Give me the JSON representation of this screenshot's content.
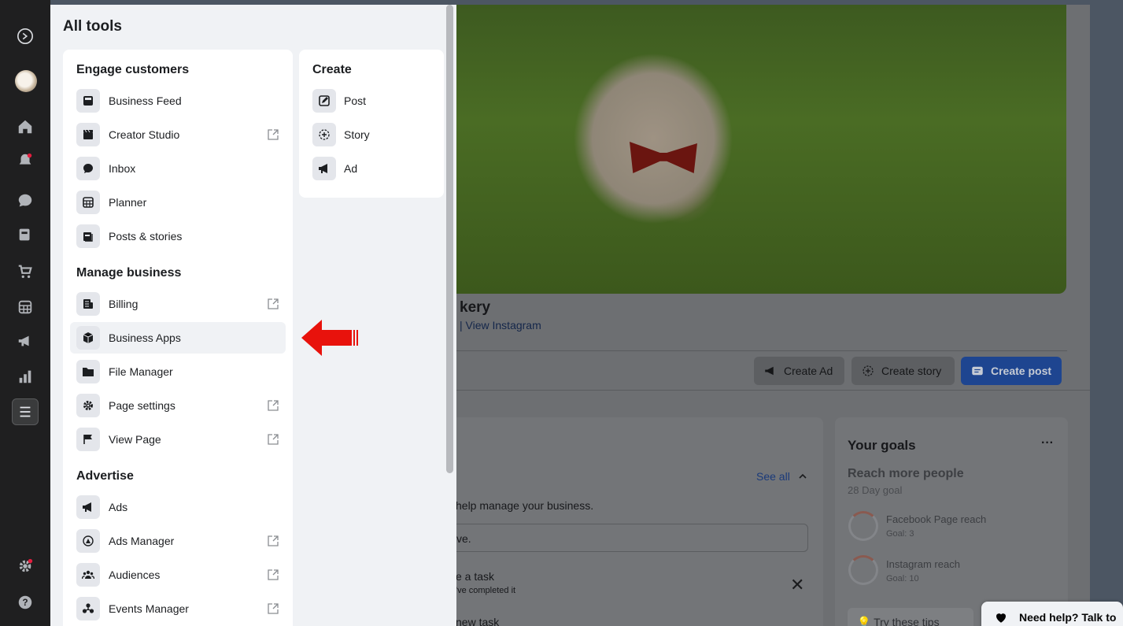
{
  "tools_panel": {
    "title": "All tools",
    "sections": {
      "engage": "Engage customers",
      "manage": "Manage business",
      "advertise": "Advertise",
      "create": "Create"
    },
    "engage_items": [
      {
        "label": "Business Feed",
        "icon": "business-feed-icon",
        "external": false
      },
      {
        "label": "Creator Studio",
        "icon": "creator-studio-icon",
        "external": true
      },
      {
        "label": "Inbox",
        "icon": "inbox-icon",
        "external": false
      },
      {
        "label": "Planner",
        "icon": "planner-icon",
        "external": false
      },
      {
        "label": "Posts & stories",
        "icon": "posts-stories-icon",
        "external": false
      }
    ],
    "manage_items": [
      {
        "label": "Billing",
        "icon": "billing-icon",
        "external": true
      },
      {
        "label": "Business Apps",
        "icon": "business-apps-icon",
        "external": false,
        "highlighted": true
      },
      {
        "label": "File Manager",
        "icon": "folder-icon",
        "external": false
      },
      {
        "label": "Page settings",
        "icon": "gear-icon",
        "external": true
      },
      {
        "label": "View Page",
        "icon": "flag-icon",
        "external": true
      }
    ],
    "advertise_items": [
      {
        "label": "Ads",
        "icon": "megaphone-icon",
        "external": false
      },
      {
        "label": "Ads Manager",
        "icon": "ads-manager-icon",
        "external": true
      },
      {
        "label": "Audiences",
        "icon": "audiences-icon",
        "external": true
      },
      {
        "label": "Events Manager",
        "icon": "events-manager-icon",
        "external": true
      }
    ],
    "create_items": [
      {
        "label": "Post",
        "icon": "compose-icon"
      },
      {
        "label": "Story",
        "icon": "story-add-icon"
      },
      {
        "label": "Ad",
        "icon": "megaphone-icon"
      }
    ]
  },
  "page": {
    "name_fragment": "kery",
    "links_fragment": "| View Instagram",
    "actions": {
      "create_ad": "Create Ad",
      "create_story": "Create story",
      "create_post": "Create post"
    },
    "tasks": {
      "see_all": "See all",
      "helper_text": "help manage your business.",
      "input_fragment": "ve.",
      "task1_title": "e a task",
      "task1_sub": "'ve completed it",
      "task2_title": "new task"
    },
    "goals": {
      "title": "Your goals",
      "more": "···",
      "headline": "Reach more people",
      "subline": "28 Day goal",
      "items": [
        {
          "label": "Facebook Page reach",
          "goal": "Goal: 3"
        },
        {
          "label": "Instagram reach",
          "goal": "Goal: 10"
        }
      ],
      "tips": "Try these tips"
    },
    "help": "Need help? Talk to"
  },
  "colors": {
    "accent": "#1877f2",
    "annotation_arrow": "#e8120c",
    "rail": "#1f1f20"
  }
}
